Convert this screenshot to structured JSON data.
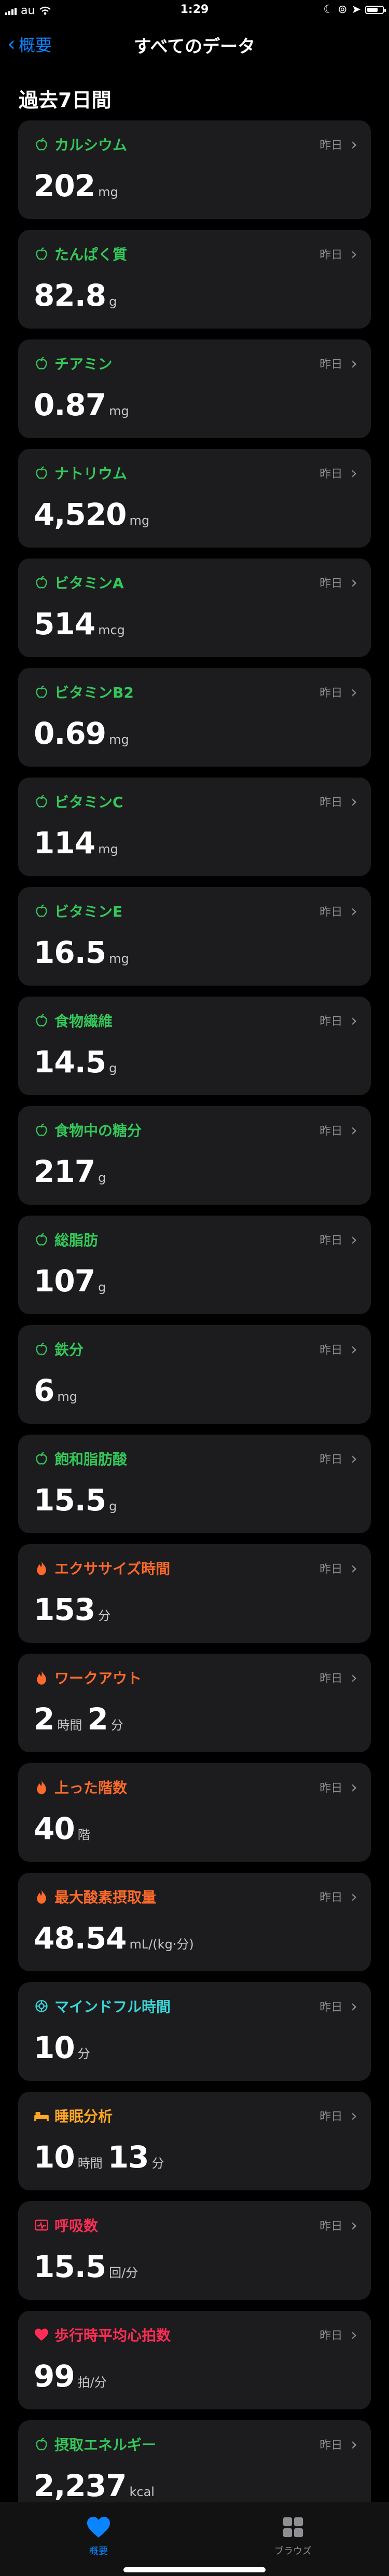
{
  "status_bar": {
    "carrier": "au",
    "time": "1:29",
    "battery_level": 0.75
  },
  "nav": {
    "back_label": "概要",
    "title": "すべてのデータ"
  },
  "section_title": "過去7日間",
  "colors": {
    "nutrition": "#34c759",
    "activity": "#ff6a2b",
    "mindfulness": "#3bd2d6",
    "sleep": "#ffa726",
    "respiratory": "#ff2d55",
    "heart": "#ff2d55",
    "accent": "#0a84ff"
  },
  "cards": [
    {
      "icon": "apple-icon",
      "category": "nutrition",
      "title": "カルシウム",
      "date": "昨日",
      "parts": [
        {
          "num": "202",
          "unit": "mg"
        }
      ]
    },
    {
      "icon": "apple-icon",
      "category": "nutrition",
      "title": "たんぱく質",
      "date": "昨日",
      "parts": [
        {
          "num": "82.8",
          "unit": "g"
        }
      ]
    },
    {
      "icon": "apple-icon",
      "category": "nutrition",
      "title": "チアミン",
      "date": "昨日",
      "parts": [
        {
          "num": "0.87",
          "unit": "mg"
        }
      ]
    },
    {
      "icon": "apple-icon",
      "category": "nutrition",
      "title": "ナトリウム",
      "date": "昨日",
      "parts": [
        {
          "num": "4,520",
          "unit": "mg"
        }
      ]
    },
    {
      "icon": "apple-icon",
      "category": "nutrition",
      "title": "ビタミンA",
      "date": "昨日",
      "parts": [
        {
          "num": "514",
          "unit": "mcg"
        }
      ]
    },
    {
      "icon": "apple-icon",
      "category": "nutrition",
      "title": "ビタミンB2",
      "date": "昨日",
      "parts": [
        {
          "num": "0.69",
          "unit": "mg"
        }
      ]
    },
    {
      "icon": "apple-icon",
      "category": "nutrition",
      "title": "ビタミンC",
      "date": "昨日",
      "parts": [
        {
          "num": "114",
          "unit": "mg"
        }
      ]
    },
    {
      "icon": "apple-icon",
      "category": "nutrition",
      "title": "ビタミンE",
      "date": "昨日",
      "parts": [
        {
          "num": "16.5",
          "unit": "mg"
        }
      ]
    },
    {
      "icon": "apple-icon",
      "category": "nutrition",
      "title": "食物繊維",
      "date": "昨日",
      "parts": [
        {
          "num": "14.5",
          "unit": "g"
        }
      ]
    },
    {
      "icon": "apple-icon",
      "category": "nutrition",
      "title": "食物中の糖分",
      "date": "昨日",
      "parts": [
        {
          "num": "217",
          "unit": "g"
        }
      ]
    },
    {
      "icon": "apple-icon",
      "category": "nutrition",
      "title": "総脂肪",
      "date": "昨日",
      "parts": [
        {
          "num": "107",
          "unit": "g"
        }
      ]
    },
    {
      "icon": "apple-icon",
      "category": "nutrition",
      "title": "鉄分",
      "date": "昨日",
      "parts": [
        {
          "num": "6",
          "unit": "mg"
        }
      ]
    },
    {
      "icon": "apple-icon",
      "category": "nutrition",
      "title": "飽和脂肪酸",
      "date": "昨日",
      "parts": [
        {
          "num": "15.5",
          "unit": "g"
        }
      ]
    },
    {
      "icon": "flame-icon",
      "category": "activity",
      "title": "エクササイズ時間",
      "date": "昨日",
      "parts": [
        {
          "num": "153",
          "unit": "分"
        }
      ]
    },
    {
      "icon": "flame-icon",
      "category": "activity",
      "title": "ワークアウト",
      "date": "昨日",
      "parts": [
        {
          "num": "2",
          "unit": "時間"
        },
        {
          "num": "2",
          "unit": "分"
        }
      ]
    },
    {
      "icon": "flame-icon",
      "category": "activity",
      "title": "上った階数",
      "date": "昨日",
      "parts": [
        {
          "num": "40",
          "unit": "階"
        }
      ]
    },
    {
      "icon": "flame-icon",
      "category": "activity",
      "title": "最大酸素摂取量",
      "date": "昨日",
      "parts": [
        {
          "num": "48.54",
          "unit": "mL/(kg·分)"
        }
      ]
    },
    {
      "icon": "mindfulness-icon",
      "category": "mindfulness",
      "title": "マインドフル時間",
      "date": "昨日",
      "parts": [
        {
          "num": "10",
          "unit": "分"
        }
      ]
    },
    {
      "icon": "bed-icon",
      "category": "sleep",
      "title": "睡眠分析",
      "date": "昨日",
      "parts": [
        {
          "num": "10",
          "unit": "時間"
        },
        {
          "num": "13",
          "unit": "分"
        }
      ]
    },
    {
      "icon": "lungs-icon",
      "category": "respiratory",
      "title": "呼吸数",
      "date": "昨日",
      "parts": [
        {
          "num": "15.5",
          "unit": "回/分"
        }
      ]
    },
    {
      "icon": "heart-icon",
      "category": "heart",
      "title": "歩行時平均心拍数",
      "date": "昨日",
      "parts": [
        {
          "num": "99",
          "unit": "拍/分"
        }
      ]
    },
    {
      "icon": "apple-icon",
      "category": "nutrition",
      "title": "摂取エネルギー",
      "date": "昨日",
      "parts": [
        {
          "num": "2,237",
          "unit": "kcal"
        }
      ]
    }
  ],
  "tab_bar": {
    "summary_label": "概要",
    "browse_label": "ブラウズ"
  }
}
